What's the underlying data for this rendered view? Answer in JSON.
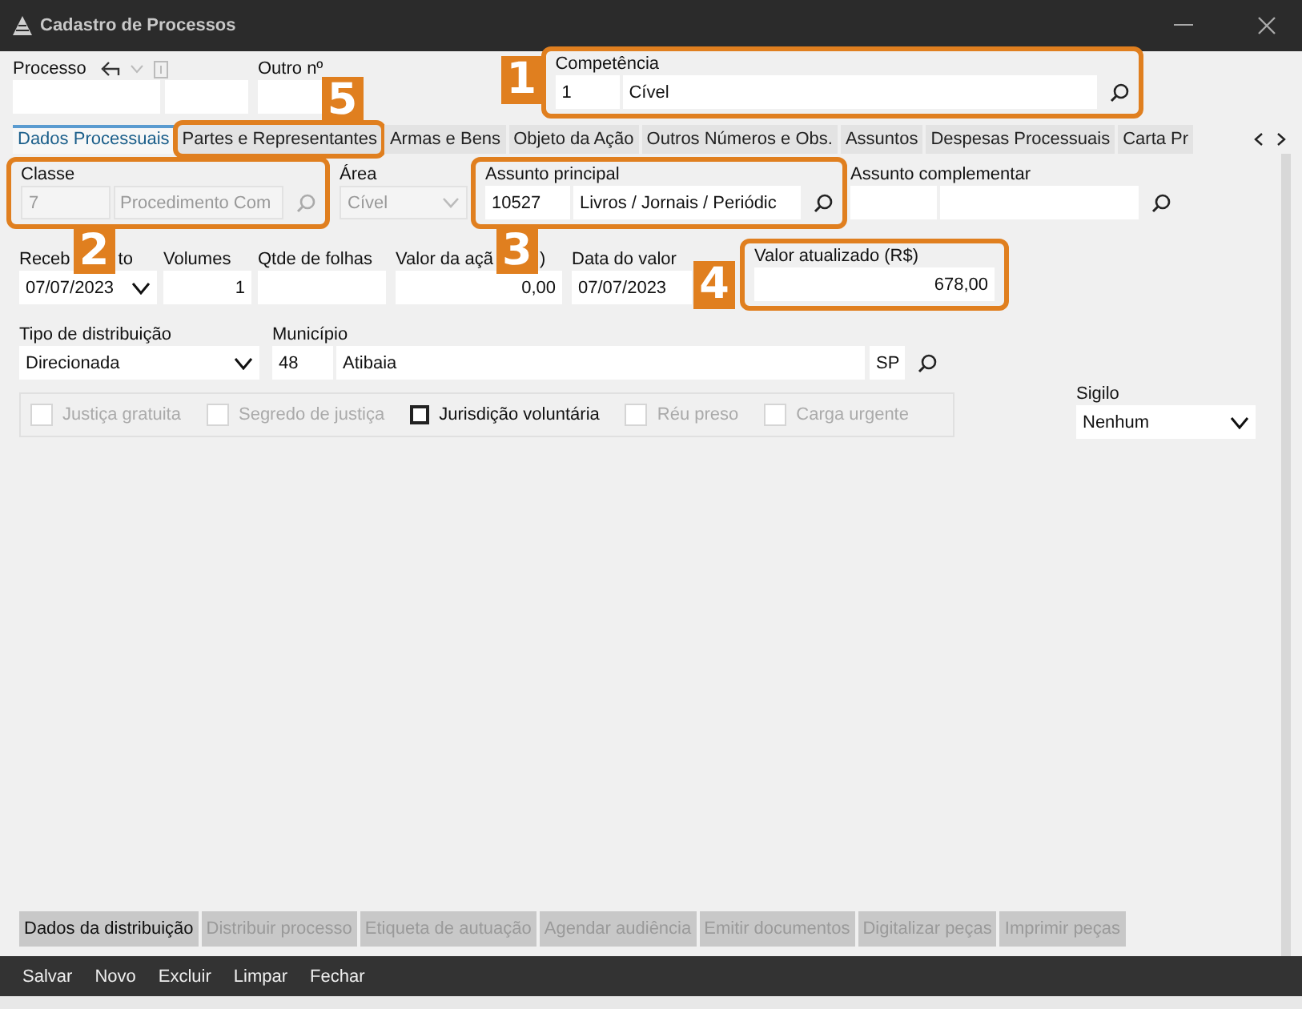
{
  "window": {
    "title": "Cadastro de Processos"
  },
  "processo": {
    "label": "Processo"
  },
  "outro_numero": {
    "label": "Outro nº"
  },
  "competencia": {
    "label": "Competência",
    "code": "1",
    "name": "Cível",
    "callout": "1"
  },
  "tabs": [
    {
      "label": "Dados Processuais",
      "selected": true
    },
    {
      "label": "Partes e Representantes",
      "selected": false,
      "callout": "5"
    },
    {
      "label": "Armas e Bens",
      "selected": false
    },
    {
      "label": "Objeto da Ação",
      "selected": false
    },
    {
      "label": "Outros Números e Obs.",
      "selected": false
    },
    {
      "label": "Assuntos",
      "selected": false
    },
    {
      "label": "Despesas Processuais",
      "selected": false
    },
    {
      "label": "Carta Pr",
      "selected": false
    }
  ],
  "classe": {
    "label": "Classe",
    "code": "7",
    "name": "Procedimento Com",
    "disabled": true,
    "callout": "2"
  },
  "area": {
    "label": "Área",
    "value": "Cível",
    "disabled": true
  },
  "assunto_principal": {
    "label": "Assunto principal",
    "code": "10527",
    "name": "Livros / Jornais / Periódic",
    "callout": "3"
  },
  "assunto_complementar": {
    "label": "Assunto complementar"
  },
  "recebimento": {
    "label_parts": [
      "Receb",
      "to"
    ],
    "value": "07/07/2023"
  },
  "volumes": {
    "label": "Volumes",
    "value": "1"
  },
  "qtde_folhas": {
    "label": "Qtde de folhas"
  },
  "valor_acao": {
    "label_parts": [
      "Valor da açã",
      ")"
    ],
    "value": "0,00"
  },
  "data_valor": {
    "label": "Data do valor",
    "value": "07/07/2023"
  },
  "valor_atualizado": {
    "label": "Valor atualizado (R$)",
    "value": "678,00",
    "callout": "4"
  },
  "tipo_distribuicao": {
    "label": "Tipo de distribuição",
    "value": "Direcionada"
  },
  "municipio": {
    "label": "Município",
    "code": "48",
    "name": "Atibaia",
    "uf": "SP"
  },
  "flags": [
    {
      "label": "Justiça gratuita",
      "checked": false,
      "disabled": true
    },
    {
      "label": "Segredo de justiça",
      "checked": false,
      "disabled": true
    },
    {
      "label": "Jurisdição voluntária",
      "checked": false,
      "disabled": false
    },
    {
      "label": "Réu preso",
      "checked": false,
      "disabled": true
    },
    {
      "label": "Carga urgente",
      "checked": false,
      "disabled": true
    }
  ],
  "sigilo": {
    "label": "Sigilo",
    "value": "Nenhum"
  },
  "actions": [
    {
      "label": "Dados da distribuição",
      "disabled": false
    },
    {
      "label": "Distribuir processo",
      "disabled": true
    },
    {
      "label": "Etiqueta de autuação",
      "disabled": true
    },
    {
      "label": "Agendar audiência",
      "disabled": true
    },
    {
      "label": "Emitir documentos",
      "disabled": true
    },
    {
      "label": "Digitalizar peças",
      "disabled": true
    },
    {
      "label": "Imprimir peças",
      "disabled": true
    }
  ],
  "footer_buttons": [
    "Salvar",
    "Novo",
    "Excluir",
    "Limpar",
    "Fechar"
  ]
}
